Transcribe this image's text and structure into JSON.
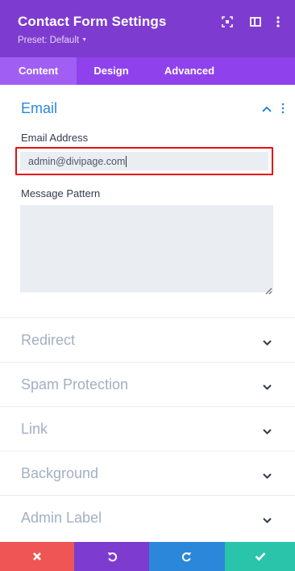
{
  "header": {
    "title": "Contact Form Settings",
    "preset": "Preset: Default",
    "colors": {
      "header_bg": "#7e3bd0",
      "tabs_bg": "#8f42ec",
      "active_tab_bg": "#a05ef3"
    },
    "icons": [
      "expand-icon",
      "sidebar-icon",
      "more-vertical-icon"
    ]
  },
  "tabs": [
    {
      "label": "Content",
      "active": true
    },
    {
      "label": "Design",
      "active": false
    },
    {
      "label": "Advanced",
      "active": false
    }
  ],
  "email_section": {
    "title": "Email",
    "email_address_label": "Email Address",
    "email_address_value": "admin@divipage.com",
    "message_pattern_label": "Message Pattern",
    "message_pattern_value": "",
    "accent_color": "#2b87da",
    "highlight_color": "#e80f0f"
  },
  "collapsed_sections": [
    {
      "label": "Redirect"
    },
    {
      "label": "Spam Protection"
    },
    {
      "label": "Link"
    },
    {
      "label": "Background"
    },
    {
      "label": "Admin Label"
    }
  ],
  "footer": {
    "buttons": [
      {
        "action": "discard",
        "icon": "close-icon",
        "color": "#ef5555"
      },
      {
        "action": "undo",
        "icon": "undo-icon",
        "color": "#7e3bd0"
      },
      {
        "action": "redo",
        "icon": "redo-icon",
        "color": "#2b87da"
      },
      {
        "action": "save",
        "icon": "check-icon",
        "color": "#29c4a9"
      }
    ]
  }
}
